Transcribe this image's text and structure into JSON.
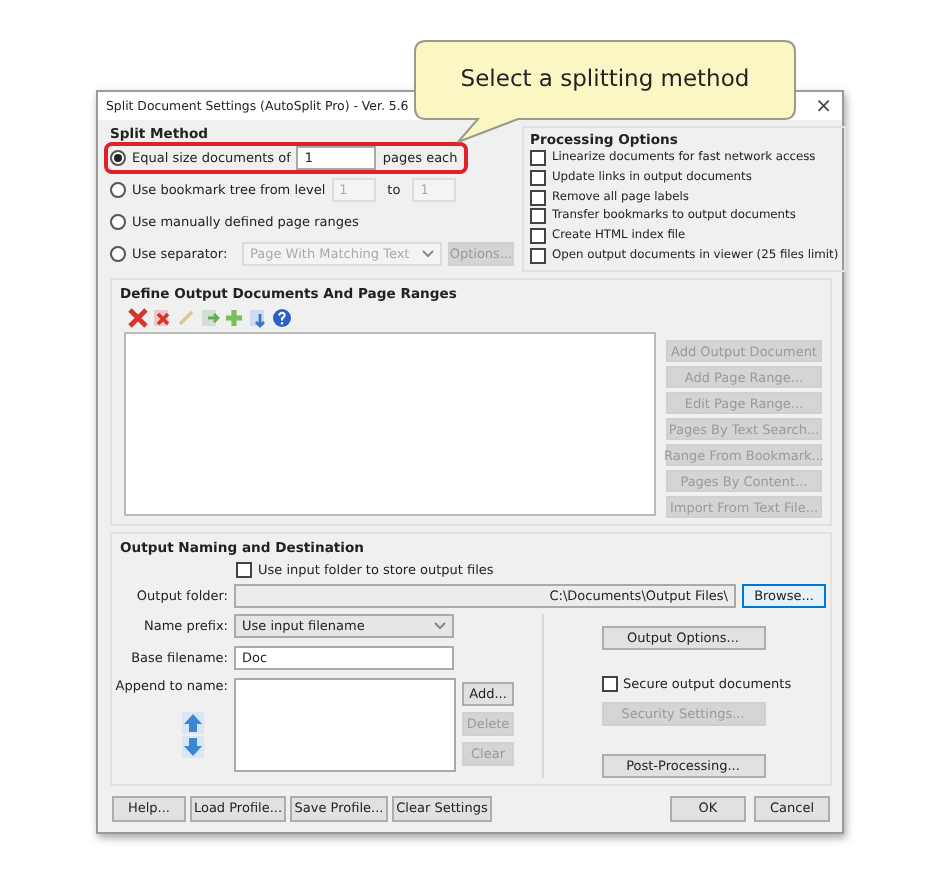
{
  "callout": {
    "text": "Select a splitting method"
  },
  "window": {
    "title": "Split Document Settings (AutoSplit Pro) - Ver. 5.6",
    "close": "×"
  },
  "split_method": {
    "title": "Split Method",
    "options": [
      {
        "kind": "count",
        "label": "Equal size documents of",
        "selected": true,
        "highlighted": true,
        "value": "1",
        "suffix": "pages each"
      },
      {
        "kind": "levels",
        "label": "Use bookmark tree from level",
        "selected": false,
        "highlighted": false,
        "from": "1",
        "to_label": "to",
        "to": "1"
      },
      {
        "kind": "plain",
        "label": "Use manually defined page ranges",
        "selected": false,
        "highlighted": false
      },
      {
        "kind": "separator",
        "label": "Use separator:",
        "selected": false,
        "highlighted": false,
        "dropdown": "Page With Matching Text",
        "button": "Options..."
      }
    ]
  },
  "processing_options": {
    "title": "Processing Options",
    "items": [
      {
        "label": "Linearize documents for fast network access",
        "checked": false
      },
      {
        "label": "Update links in output documents",
        "checked": false
      },
      {
        "label": "Remove all page labels",
        "checked": false
      },
      {
        "label": "Transfer bookmarks to output documents",
        "checked": false
      },
      {
        "label": "Create HTML index file",
        "checked": false
      },
      {
        "label": "Open output documents in viewer (25 files limit)",
        "checked": false
      }
    ]
  },
  "output_documents": {
    "title": "Define Output Documents And Page Ranges",
    "buttons": [
      {
        "label": "Add Output Document",
        "disabled": true
      },
      {
        "label": "Add Page Range...",
        "disabled": true
      },
      {
        "label": "Edit Page Range...",
        "disabled": true
      },
      {
        "label": "Pages By Text Search...",
        "disabled": true
      },
      {
        "label": "Range From Bookmark...",
        "disabled": true
      },
      {
        "label": "Pages By Content...",
        "disabled": true
      },
      {
        "label": "Import From Text File...",
        "disabled": true
      }
    ]
  },
  "output_naming": {
    "title": "Output Naming and Destination",
    "use_input_folder": {
      "label": "Use input folder to store output files",
      "checked": false
    },
    "output_folder": {
      "label": "Output folder:",
      "value": "C:\\Documents\\Output Files\\"
    },
    "browse_button": {
      "label": "Browse..."
    },
    "name_prefix": {
      "label": "Name prefix:",
      "value": "Use input filename"
    },
    "base_filename": {
      "label": "Base filename:",
      "value": "Doc"
    },
    "append_to_name": {
      "label": "Append to name:"
    },
    "append_buttons": [
      {
        "label": "Add...",
        "disabled": false
      },
      {
        "label": "Delete",
        "disabled": true
      },
      {
        "label": "Clear",
        "disabled": true
      }
    ],
    "output_options_button": {
      "label": "Output Options...",
      "disabled": false
    },
    "secure": {
      "label": "Secure output documents",
      "checked": false
    },
    "security_settings_button": {
      "label": "Security Settings...",
      "disabled": true
    },
    "post_processing_button": {
      "label": "Post-Processing...",
      "disabled": false
    }
  },
  "footer": {
    "left_buttons": [
      {
        "label": "Help..."
      },
      {
        "label": "Load Profile..."
      },
      {
        "label": "Save Profile..."
      },
      {
        "label": "Clear Settings"
      }
    ],
    "right_buttons": [
      {
        "label": "OK"
      },
      {
        "label": "Cancel"
      }
    ]
  }
}
